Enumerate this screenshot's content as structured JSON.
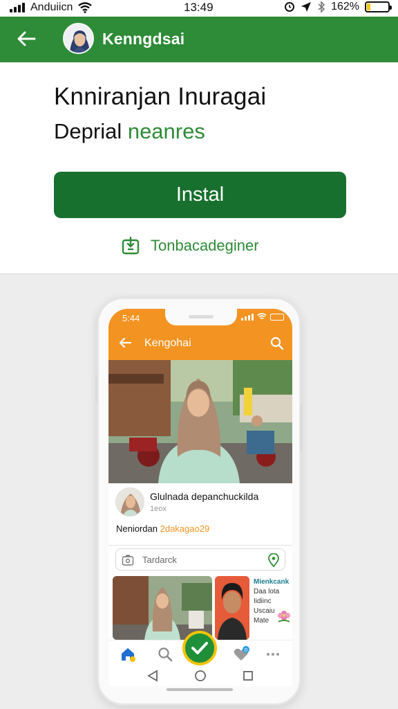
{
  "status_bar": {
    "carrier": "Anduiicn",
    "time": "13:49",
    "battery_text": "162%",
    "battery_fill": 0.18,
    "icons": [
      "signal-icon",
      "wifi-icon",
      "alarm-icon",
      "location-icon",
      "bluetooth-icon",
      "battery-icon"
    ]
  },
  "header": {
    "title": "Kenngdsai",
    "back_icon": "back-arrow-icon"
  },
  "install_card": {
    "headline": "Knniranjan Inuragai",
    "subline_prefix": "Deprial ",
    "subline_accent": "neanres",
    "install_label": "Instal",
    "secondary_label": "Tonbacadeginer",
    "secondary_icon": "download-box-icon"
  },
  "mock_app": {
    "status_time": "5:44",
    "title": "Kengohai",
    "post": {
      "name": "Glulnada depanchuckilda",
      "meta": "1eox",
      "text_prefix": "Neniordan ",
      "text_highlight": "2dakagao29"
    },
    "search_placeholder": "Tardarck",
    "side_text": [
      "Mienkcank",
      "Daa lota",
      "Iidiinc",
      "Uscaiu",
      "Mate"
    ],
    "tabs": [
      "home-icon",
      "search-icon",
      "check-icon",
      "heart-badge-icon",
      "more-icon"
    ],
    "nav": [
      "back-triangle-icon",
      "home-circle-icon",
      "recents-square-icon"
    ]
  },
  "colors": {
    "header_green": "#2e8b37",
    "install_green": "#17702e",
    "mock_orange": "#f39322",
    "fab_yellow": "#f4c400"
  }
}
